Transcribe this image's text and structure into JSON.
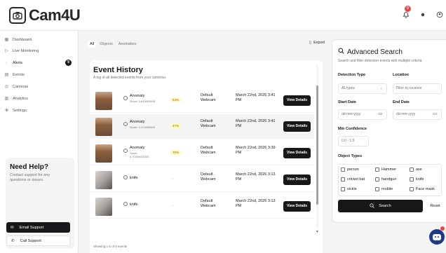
{
  "app": {
    "name": "Cam4U"
  },
  "header": {
    "notification_count": "0"
  },
  "sidebar": {
    "items": [
      {
        "label": "Dashboard",
        "icon": "grid-icon"
      },
      {
        "label": "Live Monitoring",
        "icon": "video-icon"
      },
      {
        "label": "Alerts",
        "icon": "bell-icon",
        "count": "9"
      },
      {
        "label": "Events",
        "icon": "calendar-icon"
      },
      {
        "label": "Cameras",
        "icon": "camera-icon"
      },
      {
        "label": "Analytics",
        "icon": "chart-icon"
      },
      {
        "label": "Settings",
        "icon": "gear-icon"
      }
    ],
    "help": {
      "title": "Need Help?",
      "text": "Contact support for any questions or issues.",
      "email_label": "Email Support",
      "call_label": "Call Support"
    }
  },
  "main": {
    "tabs": [
      {
        "label": "All"
      },
      {
        "label": "Objects"
      },
      {
        "label": "Anomalies"
      }
    ],
    "export_label": "Export",
    "title": "Event History",
    "subtitle": "A log of all detected events from your cameras.",
    "footer": "Showing 1-5 of 5 events",
    "rows": [
      {
        "label": "Anomaly",
        "score": "Score: 0.643091605",
        "confidence": "64%",
        "camera": "Default Webcam",
        "timestamp": "March 22nd, 2026 3:41 PM",
        "action": "View Details",
        "thumb": "person"
      },
      {
        "label": "Anomaly",
        "score": "Score: 0.474406625",
        "confidence": "47%",
        "camera": "Default Webcam",
        "timestamp": "March 22nd, 2026 3:41 PM",
        "action": "View Details",
        "thumb": "person"
      },
      {
        "label": "Anomaly",
        "score": "Score: 0.70200011033",
        "confidence": "70%",
        "camera": "Default Webcam",
        "timestamp": "March 22nd, 2026 3:39 PM",
        "action": "View Details",
        "thumb": "person"
      },
      {
        "label": "knife",
        "score": "",
        "confidence": "-",
        "camera": "Default Webcam",
        "timestamp": "March 22nd, 2026 3:13 PM",
        "action": "View Details",
        "thumb": "knife"
      },
      {
        "label": "knife",
        "score": "",
        "confidence": "-",
        "camera": "Default Webcam",
        "timestamp": "March 22nd, 2026 3:13 PM",
        "action": "View Details",
        "thumb": "knife"
      }
    ]
  },
  "search": {
    "title": "Advanced Search",
    "subtitle": "Search and filter detection events with multiple criteria",
    "detection_type_label": "Detection Type",
    "detection_type_value": "All types",
    "location_label": "Location",
    "location_placeholder": "Filter by location",
    "start_date_label": "Start Date",
    "start_date_placeholder": "dd-mm-yyyy",
    "end_date_label": "End Date",
    "end_date_placeholder": "dd-mm-yyyy",
    "min_conf_label": "Min Confidence",
    "min_conf_placeholder": "0.0 - 1.0",
    "object_types_label": "Object Types",
    "object_types": [
      "person",
      "Hammer",
      "axe",
      "cricket bat",
      "handgun",
      "knife",
      "sickle",
      "mobile",
      "Face mask"
    ],
    "search_label": "Search",
    "reset_label": "Reset"
  }
}
